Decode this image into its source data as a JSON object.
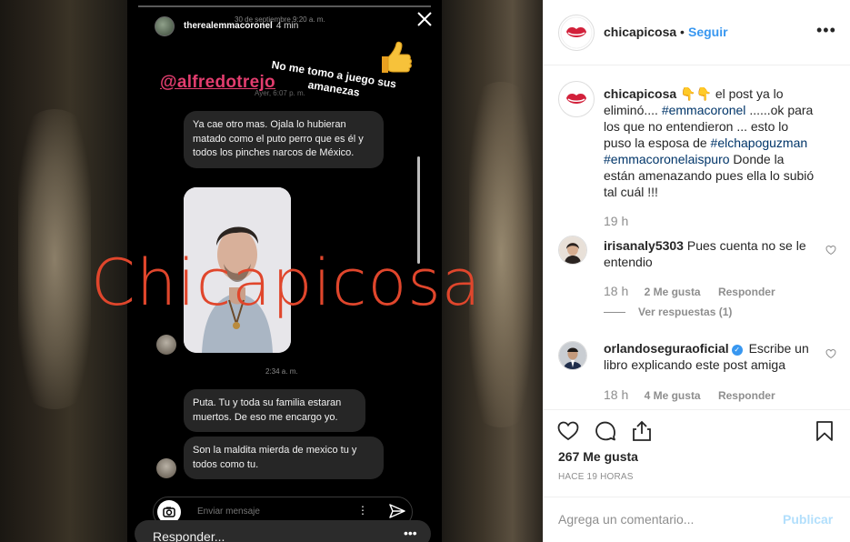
{
  "story": {
    "username": "therealemmacoronel",
    "time_ago": "4 min",
    "date_overlay": "30 de septiembre 9:20 a. m.",
    "caption_line1": "No me tomo a juego sus",
    "caption_line2": "amanezas",
    "mention": "@alfredotrejo",
    "yesterday": "Ayer, 6:07 p. m.",
    "message1": "Ya cae otro mas. Ojala lo hubieran matado como el puto perro que es él y todos los pinches narcos de México.",
    "time_mid": "2:34 a. m.",
    "message2": "Puta. Tu y toda su familia estaran muertos. De eso me encargo yo.",
    "message3": "Son la maldita mierda de mexico tu y todos como tu.",
    "message_placeholder": "Enviar mensaje",
    "reply_placeholder": "Responder...",
    "watermark": "Chicapicosa"
  },
  "header": {
    "username": "chicapicosa",
    "dot": "•",
    "follow_label": "Seguir",
    "more_label": "•••"
  },
  "caption": {
    "username": "chicapicosa",
    "emojis": "👇👇",
    "text_part1": "el post ya lo eliminó....",
    "tag1": "#emmacoronel",
    "text_part2": "......ok para los que no entendieron ... esto lo puso la esposa de",
    "tag2": "#elchapoguzman",
    "tag3": "#emmacoronelaispuro",
    "text_part3": "Donde la están amenazando pues ella lo subió tal cuál !!!",
    "time": "19 h"
  },
  "comments": [
    {
      "username": "irisanaly5303",
      "text": "Pues cuenta no se le entendio",
      "time": "18 h",
      "likes": "2 Me gusta",
      "reply": "Responder",
      "view_replies": "Ver respuestas (1)"
    },
    {
      "username": "orlandoseguraoficial",
      "text": "Escribe un libro explicando este post amiga",
      "time": "18 h",
      "likes": "4 Me gusta",
      "reply": "Responder"
    }
  ],
  "post": {
    "likes": "267 Me gusta",
    "posted_ago": "HACE 19 HORAS",
    "comment_placeholder": "Agrega un comentario...",
    "publish_label": "Publicar"
  },
  "colors": {
    "link": "#3897f0",
    "hashtag": "#003569",
    "mention": "#e23d6e",
    "watermark": "#e0462c"
  }
}
